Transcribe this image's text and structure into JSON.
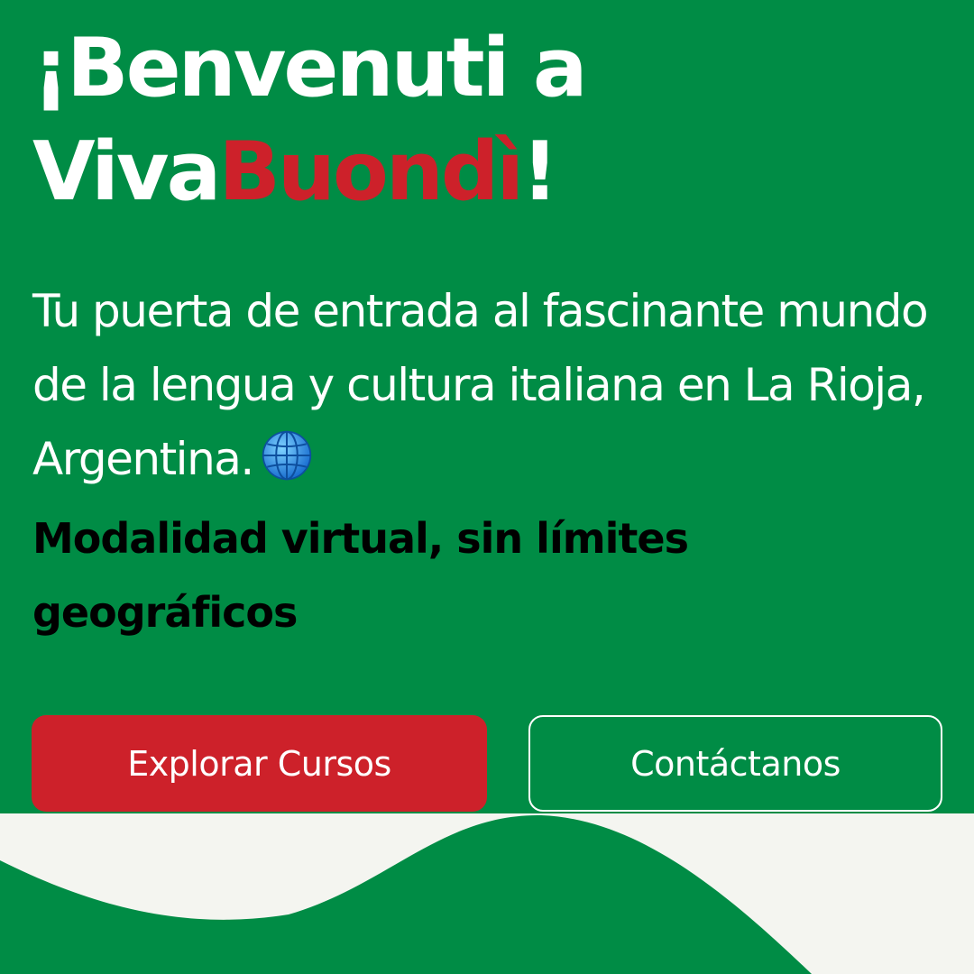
{
  "hero": {
    "title_line1": "¡Benvenuti a",
    "title_brand_prefix": "Viva",
    "title_brand_accent": "Buondì",
    "title_suffix": "!",
    "subtitle": "Tu puerta de entrada al fascinante mundo de la lengua y cultura italiana en La Rioja, Argentina.",
    "subtitle_icon": "globe-icon",
    "highlight": "Modalidad virtual, sin límites geográficos"
  },
  "buttons": {
    "primary_label": "Explorar Cursos",
    "secondary_label": "Contáctanos"
  },
  "colors": {
    "background_green": "#008c45",
    "accent_red": "#cd212a",
    "off_white": "#f4f5f0",
    "text_white": "#ffffff",
    "text_black": "#000000"
  }
}
